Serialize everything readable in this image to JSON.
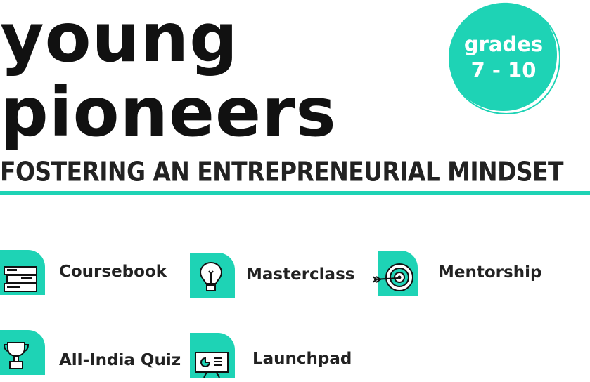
{
  "title": {
    "line1": "young",
    "line2": "pioneers"
  },
  "badge": {
    "line1": "grades",
    "line2": "7 - 10"
  },
  "tagline": "FOSTERING AN ENTREPRENEURIAL MINDSET",
  "features": [
    {
      "label": "Coursebook",
      "icon": "books-icon"
    },
    {
      "label": "Masterclass",
      "icon": "lightbulb-icon"
    },
    {
      "label": "Mentorship",
      "icon": "target-icon"
    },
    {
      "label": "All-India Quiz",
      "icon": "trophy-icon"
    },
    {
      "label": "Launchpad",
      "icon": "presentation-board-icon"
    }
  ],
  "colors": {
    "accent": "#1ed3b5",
    "text": "#111111",
    "white": "#ffffff"
  }
}
